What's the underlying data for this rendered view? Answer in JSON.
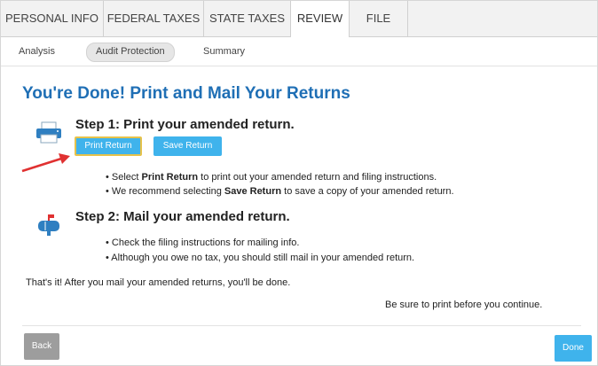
{
  "tabs": [
    {
      "label": "PERSONAL INFO"
    },
    {
      "label": "FEDERAL TAXES"
    },
    {
      "label": "STATE TAXES"
    },
    {
      "label": "REVIEW"
    },
    {
      "label": "FILE"
    }
  ],
  "subtabs": [
    {
      "label": "Analysis"
    },
    {
      "label": "Audit Protection"
    },
    {
      "label": "Summary"
    }
  ],
  "page_title": "You're Done! Print and Mail Your Returns",
  "step1": {
    "title": "Step 1: Print your amended return.",
    "print_button": "Print Return",
    "save_button": "Save Return",
    "bullet1": {
      "prefix": "• Select ",
      "bold": "Print Return",
      "suffix": " to print out your amended return and filing instructions."
    },
    "bullet2": {
      "prefix": "• We recommend selecting ",
      "bold": "Save Return",
      "suffix": " to save a copy of your amended return."
    }
  },
  "step2": {
    "title": "Step 2: Mail your amended return.",
    "bullet1": "• Check the filing instructions for mailing info.",
    "bullet2": "• Although you owe no tax, you should still mail in your amended return."
  },
  "closing_text": "That's it! After you mail your amended returns, you'll be done.",
  "reminder_text": "Be sure to print before you continue.",
  "footer": {
    "back": "Back",
    "done": "Done"
  },
  "icons": {
    "step1": "printer-icon",
    "step2": "mailbox-icon",
    "pointer": "red-arrow-icon"
  },
  "colors": {
    "accent": "#3fb3ec",
    "title": "#1f6fb5",
    "arrow": "#e03131"
  }
}
